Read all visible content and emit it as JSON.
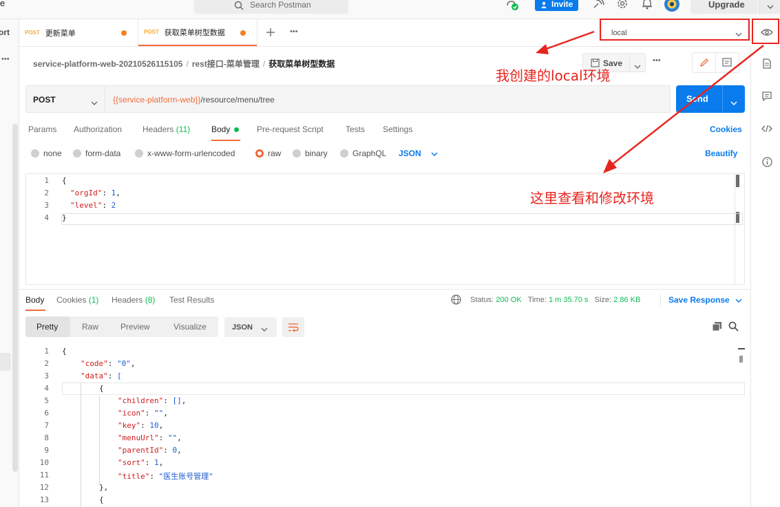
{
  "topbar": {
    "left_fragment": "e",
    "search_placeholder": "Search Postman",
    "invite_label": "Invite",
    "upgrade_label": "Upgrade"
  },
  "sidebar": {
    "left_fragment": "ort"
  },
  "tabs": [
    {
      "method": "POST",
      "title": "更新菜单"
    },
    {
      "method": "POST",
      "title": "获取菜单树型数据"
    }
  ],
  "environment": {
    "selected": "local"
  },
  "breadcrumb": {
    "collection": "service-platform-web-20210526115105",
    "folder": "rest接口-菜单管理",
    "request": "获取菜单树型数据"
  },
  "toolbar": {
    "save_label": "Save",
    "more_label": "•••"
  },
  "request": {
    "method": "POST",
    "url_variable": "{{service-platform-web}}",
    "url_path": "/resource/menu/tree",
    "send_label": "Send"
  },
  "request_tabs": {
    "params": "Params",
    "authorization": "Authorization",
    "headers": "Headers",
    "headers_count": "(11)",
    "body": "Body",
    "pre_request": "Pre-request Script",
    "tests": "Tests",
    "settings": "Settings",
    "cookies": "Cookies"
  },
  "body_types": {
    "none": "none",
    "form_data": "form-data",
    "urlencoded": "x-www-form-urlencoded",
    "raw": "raw",
    "binary": "binary",
    "graphql": "GraphQL",
    "format": "JSON",
    "beautify": "Beautify"
  },
  "request_body_lines": [
    {
      "no": "1",
      "text": "{"
    },
    {
      "no": "2",
      "key": "\"orgId\"",
      "value": "1",
      "trail": ","
    },
    {
      "no": "3",
      "key": "\"level\"",
      "value": "2",
      "trail": ""
    },
    {
      "no": "4",
      "text": "}"
    }
  ],
  "response_tabs": {
    "body": "Body",
    "cookies": "Cookies",
    "cookies_count": "(1)",
    "headers": "Headers",
    "headers_count": "(8)",
    "test_results": "Test Results"
  },
  "status": {
    "status_label": "Status:",
    "status_value": "200 OK",
    "time_label": "Time:",
    "time_value": "1 m 35.70 s",
    "size_label": "Size:",
    "size_value": "2.86 KB",
    "save_response": "Save Response"
  },
  "view_tabs": {
    "pretty": "Pretty",
    "raw": "Raw",
    "preview": "Preview",
    "visualize": "Visualize",
    "format": "JSON"
  },
  "response_lines": [
    {
      "no": "1",
      "text": "{"
    },
    {
      "no": "2",
      "key": "\"code\"",
      "value": "\"0\"",
      "trail": ","
    },
    {
      "no": "3",
      "key": "\"data\"",
      "value": "[",
      "trail": ""
    },
    {
      "no": "4",
      "text": "{"
    },
    {
      "no": "5",
      "key": "\"children\"",
      "value": "[]",
      "trail": ","
    },
    {
      "no": "6",
      "key": "\"icon\"",
      "value": "\"\"",
      "trail": ","
    },
    {
      "no": "7",
      "key": "\"key\"",
      "value": "10",
      "trail": ","
    },
    {
      "no": "8",
      "key": "\"menuUrl\"",
      "value": "\"\"",
      "trail": ","
    },
    {
      "no": "9",
      "key": "\"parentId\"",
      "value": "0",
      "trail": ","
    },
    {
      "no": "10",
      "key": "\"sort\"",
      "value": "1",
      "trail": ","
    },
    {
      "no": "11",
      "key": "\"title\"",
      "value": "\"医生账号管理\"",
      "trail": ""
    },
    {
      "no": "12",
      "text": "},"
    },
    {
      "no": "13",
      "text": "{"
    }
  ],
  "annotations": {
    "env_note": "我创建的local环境",
    "view_note": "这里查看和修改环境"
  },
  "colors": {
    "accent_orange": "#f26b3a",
    "brand_blue": "#097bed",
    "annotation_red": "#e8241e",
    "status_green": "#0cbb52"
  }
}
